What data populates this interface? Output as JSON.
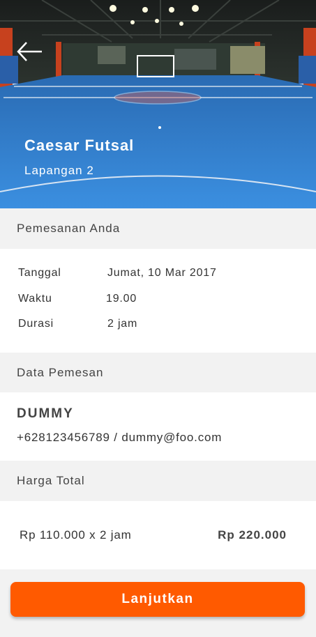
{
  "header": {
    "back_icon": "arrow-left-icon",
    "venue_name": "Caesar Futsal",
    "court": "Lapangan 2"
  },
  "booking": {
    "heading": "Pemesanan Anda",
    "rows": [
      {
        "label": "Tanggal",
        "value": "Jumat, 10 Mar 2017"
      },
      {
        "label": "Waktu",
        "value": "19.00"
      },
      {
        "label": "Durasi",
        "value": "2 jam"
      }
    ]
  },
  "customer": {
    "heading": "Data Pemesan",
    "name": "DUMMY",
    "contact": "+628123456789 / dummy@foo.com"
  },
  "price": {
    "heading": "Harga Total",
    "calculation": "Rp 110.000 x 2 jam",
    "total": "Rp 220.000"
  },
  "actions": {
    "continue_label": "Lanjutkan"
  },
  "colors": {
    "accent": "#ff5a00",
    "court_blue": "#2f7fd0"
  }
}
